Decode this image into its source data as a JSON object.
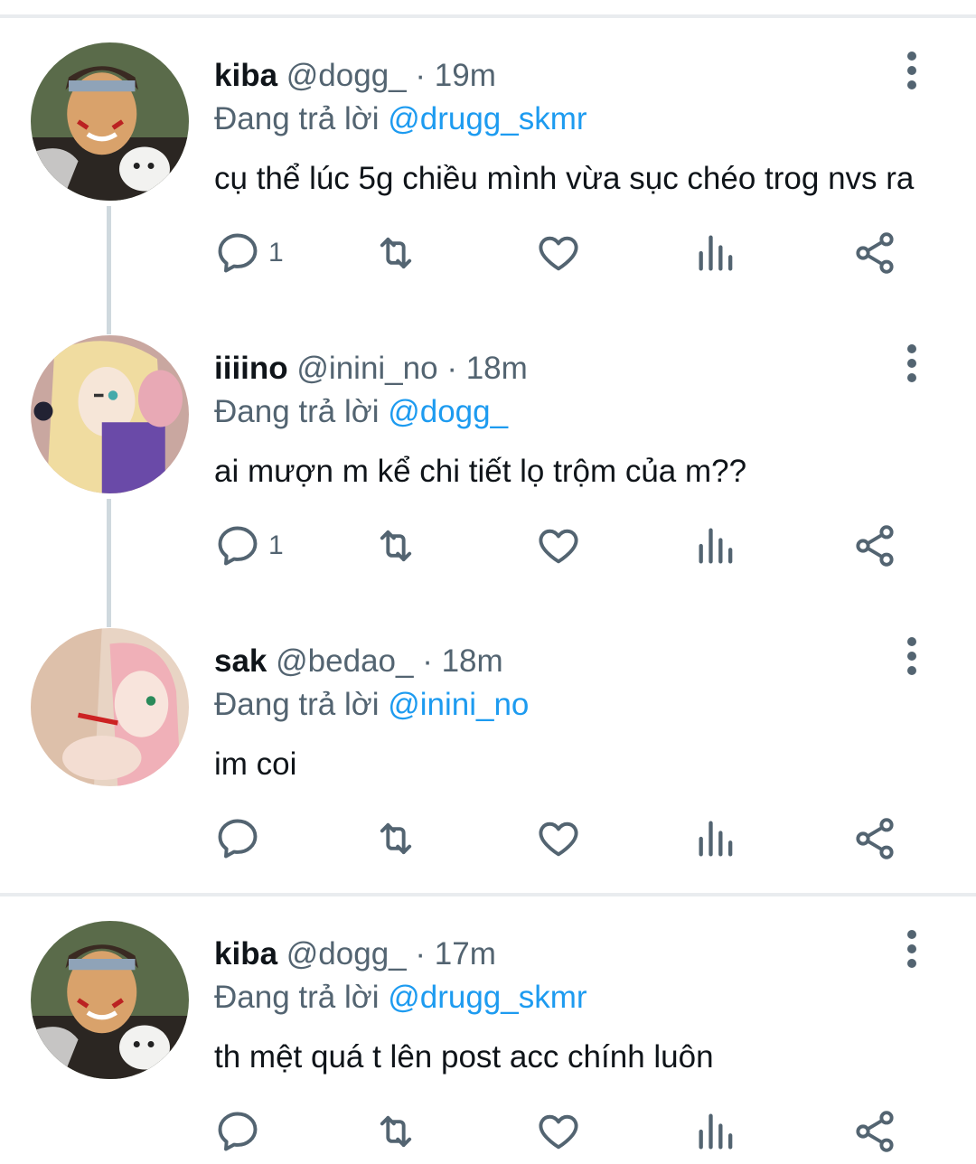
{
  "tweets": [
    {
      "name": "kiba",
      "handle": "@dogg_",
      "separator": "·",
      "time": "19m",
      "reply_prefix": "Đang trả lời",
      "reply_to": "@drugg_skmr",
      "text": "cụ thể lúc 5g chiều mình vừa sục chéo trog nvs ra",
      "reply_count": "1",
      "avatar": "kiba-avatar"
    },
    {
      "name": "iiiino",
      "handle": "@inini_no",
      "separator": "·",
      "time": "18m",
      "reply_prefix": "Đang trả lời",
      "reply_to": "@dogg_",
      "text": "ai mượn m kể chi tiết lọ trộm của m??",
      "reply_count": "1",
      "avatar": "ino-avatar"
    },
    {
      "name": "sak",
      "handle": "@bedao_",
      "separator": "·",
      "time": "18m",
      "reply_prefix": "Đang trả lời",
      "reply_to": "@inini_no",
      "text": "im coi",
      "reply_count": "",
      "avatar": "sakura-avatar"
    },
    {
      "name": "kiba",
      "handle": "@dogg_",
      "separator": "·",
      "time": "17m",
      "reply_prefix": "Đang trả lời",
      "reply_to": "@drugg_skmr",
      "text": "th mệt quá t lên post acc chính luôn",
      "reply_count": "",
      "avatar": "kiba-avatar"
    }
  ],
  "icons": {
    "reply": "reply-icon",
    "retweet": "retweet-icon",
    "like": "heart-icon",
    "views": "analytics-icon",
    "share": "share-icon",
    "more": "more-vertical-icon"
  },
  "colors": {
    "link": "#1d9bf0",
    "secondary_text": "#536471",
    "primary_text": "#0f1419",
    "thread_line": "#cfd9de",
    "divider": "#e9ecef"
  }
}
